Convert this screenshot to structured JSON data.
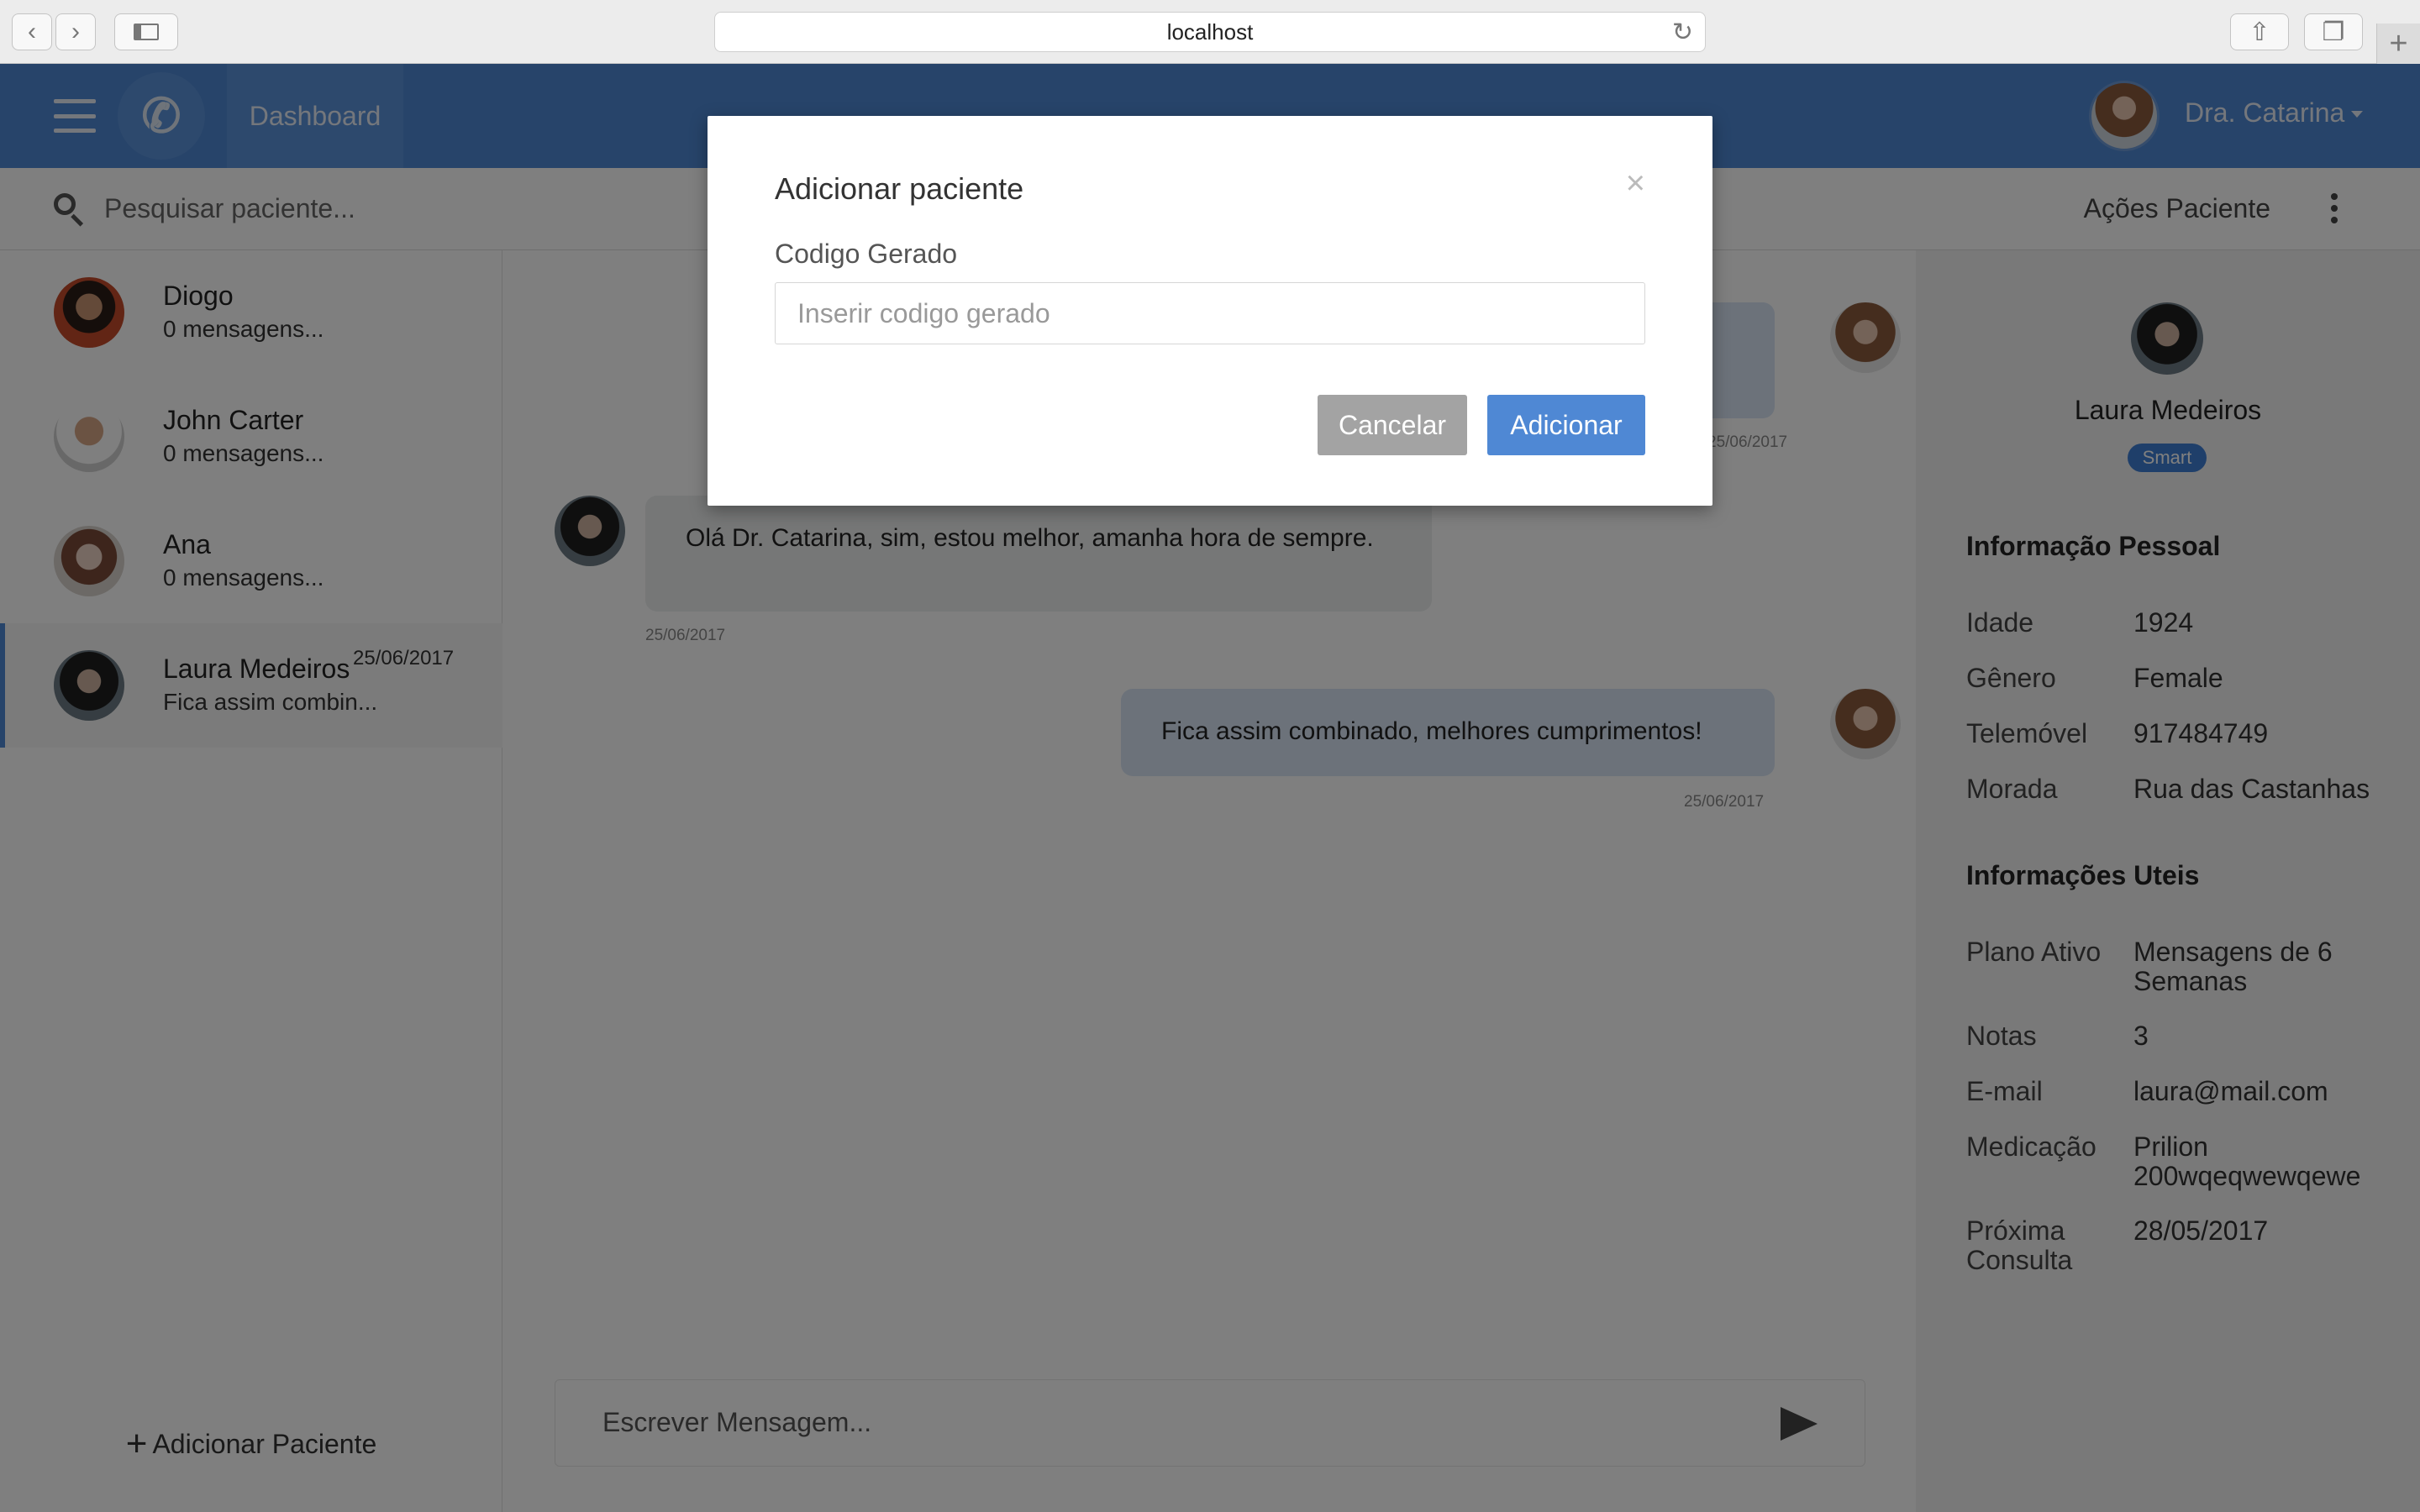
{
  "browser": {
    "url": "localhost"
  },
  "header": {
    "dashboard_label": "Dashboard",
    "user_name": "Dra. Catarina"
  },
  "search": {
    "placeholder": "Pesquisar paciente..."
  },
  "patient_actions_label": "Ações Paciente",
  "contacts": [
    {
      "name": "Diogo",
      "preview": "0 mensagens...",
      "date": ""
    },
    {
      "name": "John Carter",
      "preview": "0 mensagens...",
      "date": ""
    },
    {
      "name": "Ana",
      "preview": "0 mensagens...",
      "date": ""
    },
    {
      "name": "Laura Medeiros",
      "preview": "Fica assim combin...",
      "date": "25/06/2017"
    }
  ],
  "add_patient_label": "Adicionar Paciente",
  "messages": [
    {
      "direction": "out",
      "text": "",
      "timestamp": "25/06/2017"
    },
    {
      "direction": "in",
      "text": "Olá Dr. Catarina, sim, estou melhor, amanha hora de sempre.",
      "timestamp": "25/06/2017"
    },
    {
      "direction": "out",
      "text": "Fica assim combinado, melhores cumprimentos!",
      "timestamp": "25/06/2017"
    }
  ],
  "compose": {
    "placeholder": "Escrever Mensagem..."
  },
  "patient": {
    "name": "Laura Medeiros",
    "badge": "Smart",
    "personal_title": "Informação Pessoal",
    "personal": [
      {
        "key": "Idade",
        "value": "1924"
      },
      {
        "key": "Gênero",
        "value": "Female"
      },
      {
        "key": "Telemóvel",
        "value": "917484749"
      },
      {
        "key": "Morada",
        "value": "Rua das Castanhas"
      }
    ],
    "useful_title": "Informações Uteis",
    "useful": [
      {
        "key": "Plano Ativo",
        "value": "Mensagens de 6 Semanas"
      },
      {
        "key": "Notas",
        "value": "3"
      },
      {
        "key": "E-mail",
        "value": "laura@mail.com"
      },
      {
        "key": "Medicação",
        "value": "Prilion 200wqeqwewqewe"
      },
      {
        "key": "Próxima Consulta",
        "value": "28/05/2017"
      }
    ]
  },
  "modal": {
    "title": "Adicionar paciente",
    "close_symbol": "×",
    "field_label": "Codigo Gerado",
    "field_placeholder": "Inserir codigo gerado",
    "field_value": "",
    "cancel_label": "Cancelar",
    "add_label": "Adicionar"
  },
  "colors": {
    "primary": "#4f88d4",
    "badge": "#3f7fd4",
    "cancel_button": "#a3a3a3",
    "outgoing_bubble": "#d8e4f5",
    "incoming_bubble": "#eceeef"
  }
}
